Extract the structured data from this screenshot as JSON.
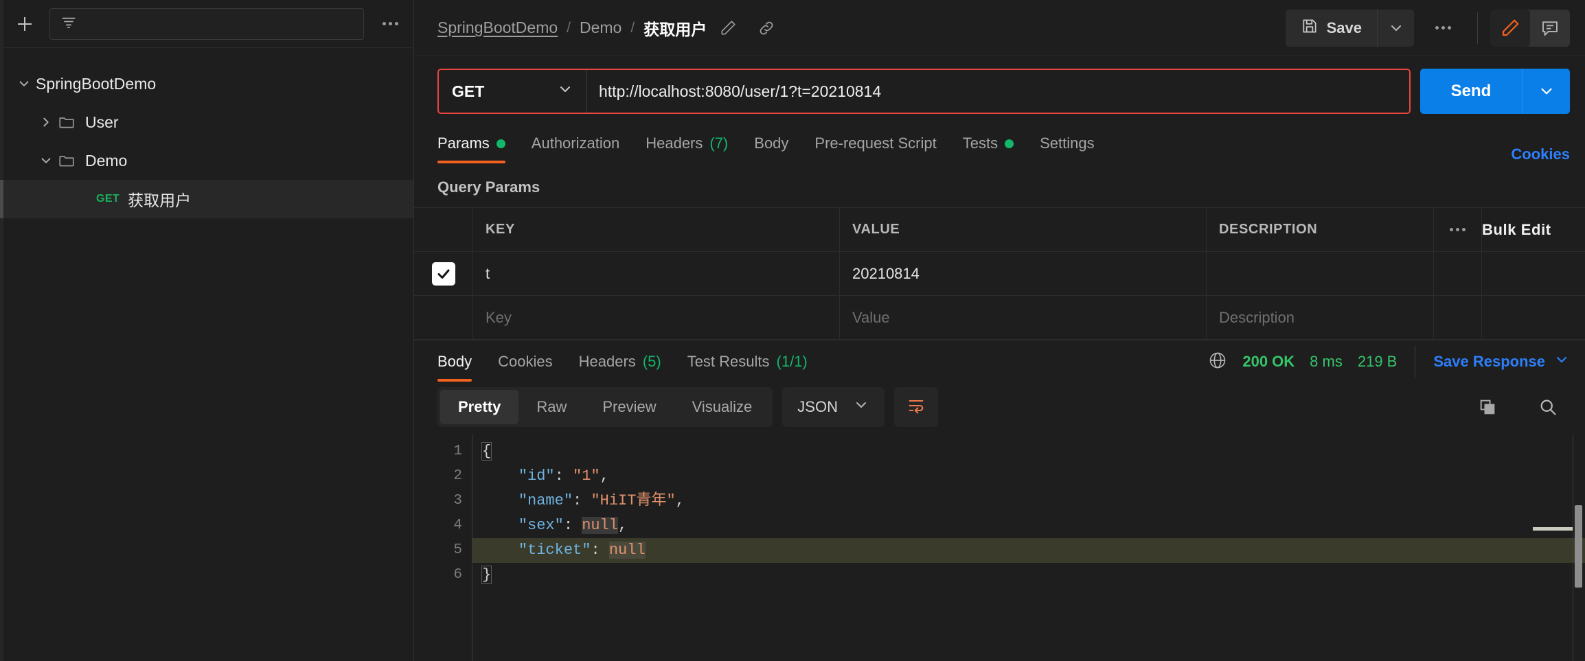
{
  "sidebar": {
    "new_button": "+",
    "filter_placeholder": "",
    "more_icon": "ellipsis-icon",
    "tree": [
      {
        "label": "SpringBootDemo",
        "level": 0,
        "expanded": true,
        "type": "collection"
      },
      {
        "label": "User",
        "level": 1,
        "expanded": false,
        "type": "folder"
      },
      {
        "label": "Demo",
        "level": 1,
        "expanded": true,
        "type": "folder"
      },
      {
        "label": "获取用户",
        "level": 2,
        "method": "GET",
        "type": "request",
        "selected": true
      }
    ]
  },
  "breadcrumb": {
    "items": [
      "SpringBootDemo",
      "Demo",
      "获取用户"
    ],
    "separator": "/",
    "edit_icon": "pencil-icon",
    "link_icon": "link-icon"
  },
  "toolbar": {
    "save_label": "Save",
    "save_icon": "floppy-disk-icon",
    "save_caret_icon": "chevron-down-icon",
    "more_icon": "ellipsis-icon",
    "edit_toggle_icon": "pencil-icon",
    "comment_toggle_icon": "comment-icon",
    "accent_orange": "#f2621e"
  },
  "request": {
    "method": "GET",
    "method_caret_icon": "chevron-down-icon",
    "url": "http://localhost:8080/user/1?t=20210814",
    "highlight_color": "#e8463f",
    "send_label": "Send",
    "send_caret_icon": "chevron-down-icon",
    "send_color": "#0b7fe8"
  },
  "request_tabs": {
    "items": [
      {
        "label": "Params",
        "dot": true,
        "active": true
      },
      {
        "label": "Authorization",
        "dot": false,
        "active": false
      },
      {
        "label": "Headers",
        "count": "(7)",
        "active": false
      },
      {
        "label": "Body",
        "active": false
      },
      {
        "label": "Pre-request Script",
        "active": false
      },
      {
        "label": "Tests",
        "dot": true,
        "active": false
      },
      {
        "label": "Settings",
        "active": false
      }
    ],
    "cookies_link": "Cookies"
  },
  "query_params": {
    "title": "Query Params",
    "columns": [
      "KEY",
      "VALUE",
      "DESCRIPTION"
    ],
    "bulk_edit_label": "Bulk Edit",
    "more_icon": "ellipsis-icon",
    "rows": [
      {
        "checked": true,
        "key": "t",
        "value": "20210814",
        "description": ""
      }
    ],
    "new_row_placeholders": {
      "key": "Key",
      "value": "Value",
      "description": "Description"
    }
  },
  "response": {
    "tabs": [
      {
        "label": "Body",
        "active": true
      },
      {
        "label": "Cookies",
        "active": false
      },
      {
        "label": "Headers",
        "count": "(5)",
        "active": false
      },
      {
        "label": "Test Results",
        "count": "(1/1)",
        "active": false
      }
    ],
    "globe_icon": "globe-icon",
    "status": "200 OK",
    "time": "8 ms",
    "size": "219 B",
    "save_response_label": "Save Response",
    "save_response_caret_icon": "chevron-down-icon",
    "view_modes": [
      {
        "label": "Pretty",
        "active": true
      },
      {
        "label": "Raw",
        "active": false
      },
      {
        "label": "Preview",
        "active": false
      },
      {
        "label": "Visualize",
        "active": false
      }
    ],
    "format": "JSON",
    "format_caret_icon": "chevron-down-icon",
    "wrap_icon": "word-wrap-icon",
    "copy_icon": "copy-icon",
    "search_icon": "search-icon",
    "body_lines": [
      {
        "num": "1",
        "tokens": [
          {
            "t": "{",
            "c": "brace"
          }
        ]
      },
      {
        "num": "2",
        "tokens": [
          {
            "t": "    ",
            "c": "p"
          },
          {
            "t": "\"id\"",
            "c": "k"
          },
          {
            "t": ": ",
            "c": "p"
          },
          {
            "t": "\"1\"",
            "c": "s"
          },
          {
            "t": ",",
            "c": "p"
          }
        ]
      },
      {
        "num": "3",
        "tokens": [
          {
            "t": "    ",
            "c": "p"
          },
          {
            "t": "\"name\"",
            "c": "k"
          },
          {
            "t": ": ",
            "c": "p"
          },
          {
            "t": "\"HiIT青年\"",
            "c": "s"
          },
          {
            "t": ",",
            "c": "p"
          }
        ]
      },
      {
        "num": "4",
        "tokens": [
          {
            "t": "    ",
            "c": "p"
          },
          {
            "t": "\"sex\"",
            "c": "k"
          },
          {
            "t": ": ",
            "c": "p"
          },
          {
            "t": "null",
            "c": "n nullbg"
          },
          {
            "t": ",",
            "c": "p"
          }
        ]
      },
      {
        "num": "5",
        "highlight": true,
        "tokens": [
          {
            "t": "    ",
            "c": "p"
          },
          {
            "t": "\"ticket\"",
            "c": "k"
          },
          {
            "t": ": ",
            "c": "p"
          },
          {
            "t": "null",
            "c": "n nullbg2"
          }
        ]
      },
      {
        "num": "6",
        "tokens": [
          {
            "t": "}",
            "c": "brace"
          }
        ]
      }
    ]
  }
}
